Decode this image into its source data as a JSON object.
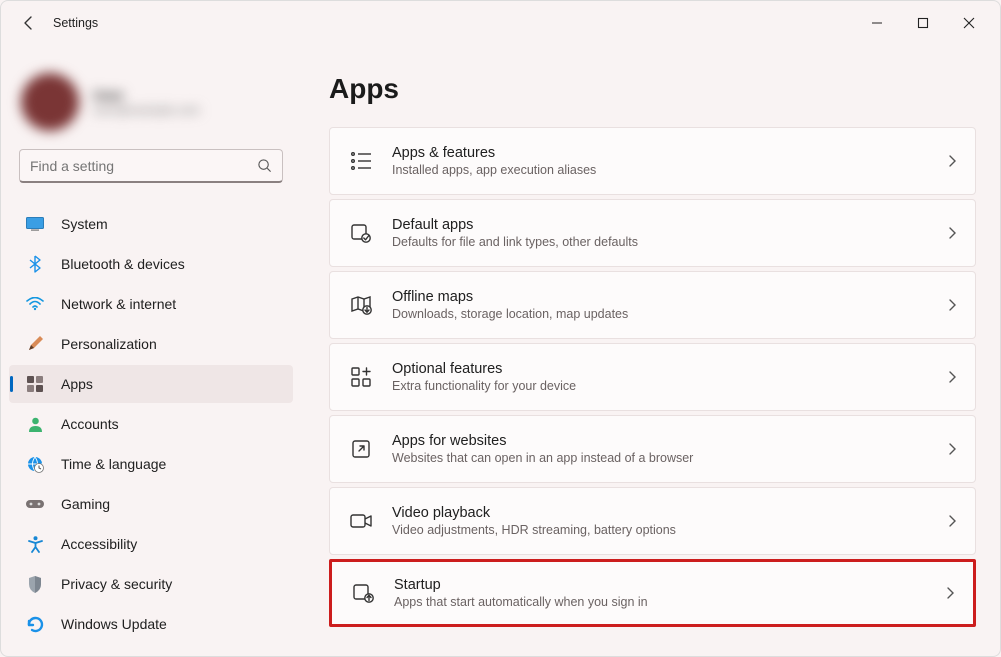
{
  "app": {
    "title": "Settings"
  },
  "user": {
    "name": "User",
    "email": "user@example.com"
  },
  "search": {
    "placeholder": "Find a setting"
  },
  "sidebar": {
    "items": [
      {
        "label": "System"
      },
      {
        "label": "Bluetooth & devices"
      },
      {
        "label": "Network & internet"
      },
      {
        "label": "Personalization"
      },
      {
        "label": "Apps"
      },
      {
        "label": "Accounts"
      },
      {
        "label": "Time & language"
      },
      {
        "label": "Gaming"
      },
      {
        "label": "Accessibility"
      },
      {
        "label": "Privacy & security"
      },
      {
        "label": "Windows Update"
      }
    ]
  },
  "page": {
    "title": "Apps"
  },
  "cards": [
    {
      "title": "Apps & features",
      "sub": "Installed apps, app execution aliases"
    },
    {
      "title": "Default apps",
      "sub": "Defaults for file and link types, other defaults"
    },
    {
      "title": "Offline maps",
      "sub": "Downloads, storage location, map updates"
    },
    {
      "title": "Optional features",
      "sub": "Extra functionality for your device"
    },
    {
      "title": "Apps for websites",
      "sub": "Websites that can open in an app instead of a browser"
    },
    {
      "title": "Video playback",
      "sub": "Video adjustments, HDR streaming, battery options"
    },
    {
      "title": "Startup",
      "sub": "Apps that start automatically when you sign in"
    }
  ]
}
